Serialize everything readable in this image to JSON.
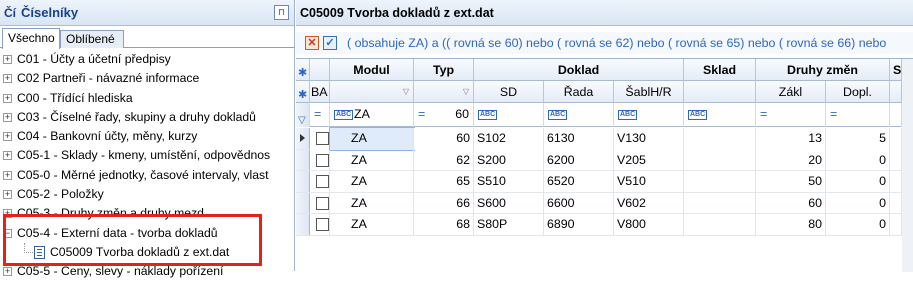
{
  "left": {
    "title": "Číselníky",
    "pin_icon": "pin-icon",
    "tabs": [
      "Všechno",
      "Oblíbené"
    ],
    "tree": [
      {
        "sign": "+",
        "label": "C01 - Účty a účetní předpisy"
      },
      {
        "sign": "+",
        "label": "C02 Partneři - návazné informace"
      },
      {
        "sign": "+",
        "label": "C00 - Třídící hlediska"
      },
      {
        "sign": "+",
        "label": "C03 - Číselné řady, skupiny a druhy dokladů"
      },
      {
        "sign": "+",
        "label": "C04 - Bankovní účty, měny, kurzy"
      },
      {
        "sign": "+",
        "label": "C05-1 - Sklady - kmeny, umístění, odpovědnos"
      },
      {
        "sign": "+",
        "label": "C05-0 - Měrné jednotky, časové intervaly, vlast"
      },
      {
        "sign": "+",
        "label": "C05-2 - Položky"
      },
      {
        "sign": "+",
        "label": "C05-3 - Druhy změn a druhy mezd"
      },
      {
        "sign": "−",
        "label": "C05-4 - Externí data - tvorba dokladů"
      },
      {
        "sign": "",
        "label": "C05009 Tvorba dokladů z ext.dat"
      },
      {
        "sign": "+",
        "label": "C05-5 - Ceny, slevy - náklady pořízení"
      }
    ]
  },
  "right": {
    "title": "C05009 Tvorba dokladů z ext.dat",
    "filter_text": "( obsahuje ZA) a  (( rovná se 60) nebo ( rovná se 62) nebo ( rovná se 65) nebo ( rovná se 66) nebo",
    "filter_clear_icon": "close-icon",
    "filter_apply_icon": "checkmark-icon",
    "headers_top": {
      "modul": "Modul",
      "typ": "Typ",
      "doklad": "Doklad",
      "sklad": "Sklad",
      "druhy_zmen": "Druhy změn",
      "s": "S"
    },
    "headers_sub": {
      "ba": "BA",
      "sd": "SD",
      "rada": "Řada",
      "sablhr": "ŠablH/R",
      "zakl": "Zákl",
      "dopl": "Dopl."
    },
    "filter_row": {
      "modul_op": "=",
      "modul_val": "ZA",
      "typ_op": "=",
      "typ_val": "60",
      "zakl_op": "=",
      "dopl_op": "="
    },
    "rows": [
      {
        "modul": "ZA",
        "typ": "60",
        "sd": "S102",
        "rada": "6130",
        "sablhr": "V130",
        "zakl": "13",
        "dopl": "5"
      },
      {
        "modul": "ZA",
        "typ": "62",
        "sd": "S200",
        "rada": "6200",
        "sablhr": "V205",
        "zakl": "20",
        "dopl": "0"
      },
      {
        "modul": "ZA",
        "typ": "65",
        "sd": "S510",
        "rada": "6520",
        "sablhr": "V510",
        "zakl": "50",
        "dopl": "0"
      },
      {
        "modul": "ZA",
        "typ": "66",
        "sd": "S600",
        "rada": "6600",
        "sablhr": "V602",
        "zakl": "60",
        "dopl": "0"
      },
      {
        "modul": "ZA",
        "typ": "68",
        "sd": "S80P",
        "rada": "6890",
        "sablhr": "V800",
        "zakl": "80",
        "dopl": "0"
      }
    ]
  }
}
